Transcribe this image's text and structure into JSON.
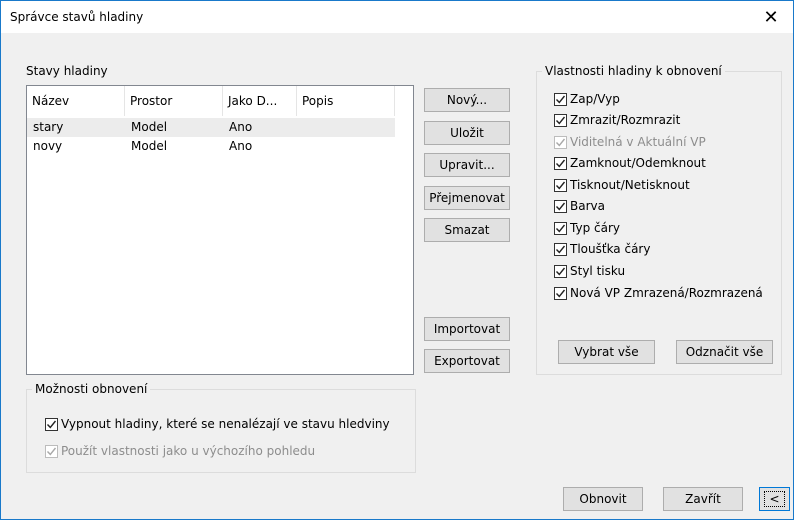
{
  "window": {
    "title": "Správce stavů hladiny",
    "close_glyph": "✕"
  },
  "states": {
    "group_label": "Stavy hladiny",
    "columns": [
      "Název",
      "Prostor",
      "Jako D...",
      "Popis"
    ],
    "rows": [
      {
        "name": "stary",
        "space": "Model",
        "as": "Ano",
        "desc": ""
      },
      {
        "name": "novy",
        "space": "Model",
        "as": "Ano",
        "desc": ""
      }
    ]
  },
  "actions": {
    "new": "Nový...",
    "save": "Uložit",
    "edit": "Upravit...",
    "rename": "Přejmenovat",
    "delete": "Smazat",
    "import": "Importovat",
    "export": "Exportovat"
  },
  "properties": {
    "group_label": "Vlastnosti hladiny k obnovení",
    "items": [
      {
        "label": "Zap/Vyp",
        "checked": true,
        "disabled": false
      },
      {
        "label": "Zmrazit/Rozmrazit",
        "checked": true,
        "disabled": false
      },
      {
        "label": "Viditelná v Aktuální VP",
        "checked": true,
        "disabled": true
      },
      {
        "label": "Zamknout/Odemknout",
        "checked": true,
        "disabled": false
      },
      {
        "label": "Tisknout/Netisknout",
        "checked": true,
        "disabled": false
      },
      {
        "label": "Barva",
        "checked": true,
        "disabled": false
      },
      {
        "label": "Typ čáry",
        "checked": true,
        "disabled": false
      },
      {
        "label": "Tloušťka čáry",
        "checked": true,
        "disabled": false
      },
      {
        "label": "Styl tisku",
        "checked": true,
        "disabled": false
      },
      {
        "label": "Nová VP Zmrazená/Rozmrazená",
        "checked": true,
        "disabled": false
      }
    ],
    "select_all": "Vybrat vše",
    "clear_all": "Odznačit vše"
  },
  "restore_options": {
    "group_label": "Možnosti obnovení",
    "turn_off": "Vypnout hladiny, které se nenalézají ve stavu hledviny",
    "use_props": "Použít vlastnosti jako u výchozího pohledu"
  },
  "footer": {
    "restore": "Obnovit",
    "close": "Zavřít",
    "collapse": "<"
  }
}
